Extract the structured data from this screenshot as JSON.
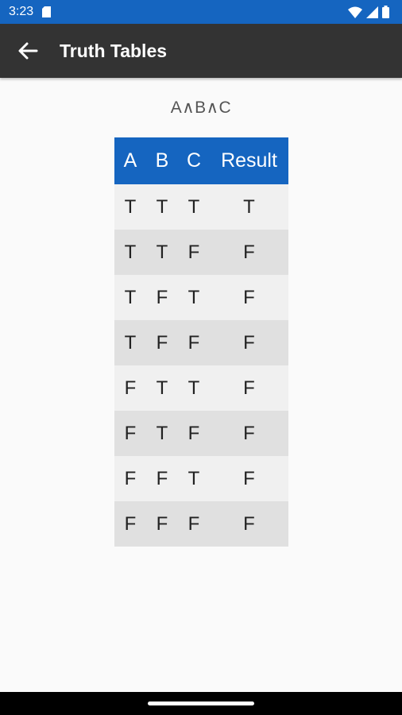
{
  "status_bar": {
    "time": "3:23",
    "icons": [
      "sim-card-icon",
      "wifi-icon",
      "signal-icon",
      "battery-icon"
    ]
  },
  "app_bar": {
    "title": "Truth Tables",
    "back_icon": "arrow-back-icon"
  },
  "expression": "A∧B∧C",
  "table": {
    "headers": [
      "A",
      "B",
      "C",
      "Result"
    ],
    "rows": [
      [
        "T",
        "T",
        "T",
        "T"
      ],
      [
        "T",
        "T",
        "F",
        "F"
      ],
      [
        "T",
        "F",
        "T",
        "F"
      ],
      [
        "T",
        "F",
        "F",
        "F"
      ],
      [
        "F",
        "T",
        "T",
        "F"
      ],
      [
        "F",
        "T",
        "F",
        "F"
      ],
      [
        "F",
        "F",
        "T",
        "F"
      ],
      [
        "F",
        "F",
        "F",
        "F"
      ]
    ]
  },
  "colors": {
    "status_bar": "#1565c0",
    "app_bar": "#333333",
    "table_header": "#1565c0",
    "row_light": "#f0f0f0",
    "row_dark": "#e0e0e0"
  }
}
